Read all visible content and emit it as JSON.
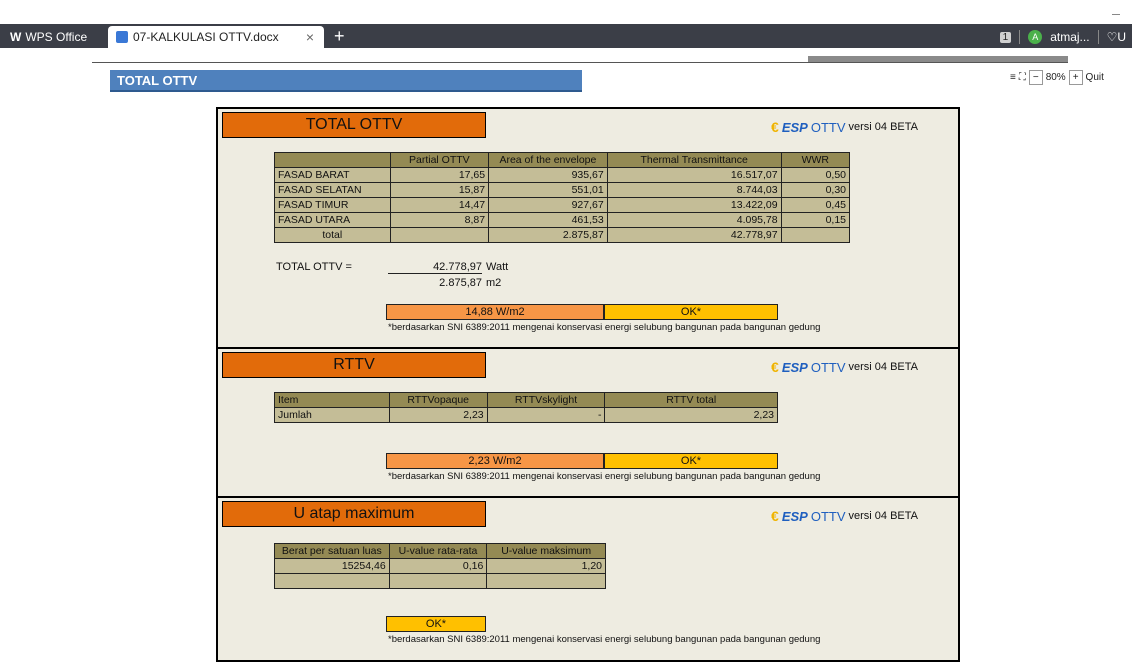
{
  "app": {
    "home_tab": "WPS Office",
    "doc_tab": "07-KALKULASI OTTV.docx",
    "tab_close": "×",
    "tab_add": "+",
    "window_badge": "1",
    "user_initial": "A",
    "user_name": "atmaj...",
    "right_label": "♡U"
  },
  "view": {
    "zoom": "80%",
    "zoom_minus": "−",
    "zoom_plus": "+",
    "quit": "Quit"
  },
  "doc": {
    "heading": "TOTAL OTTV"
  },
  "brand": {
    "euro": "€",
    "esp": "ESP",
    "ottv": "OTTV",
    "version": "versi 04 BETA"
  },
  "total_ottv": {
    "title": "TOTAL  OTTV",
    "headers": [
      "",
      "Partial OTTV",
      "Area of the envelope",
      "Thermal Transmittance",
      "WWR"
    ],
    "rows": [
      [
        "FASAD BARAT",
        "17,65",
        "935,67",
        "16.517,07",
        "0,50"
      ],
      [
        "FASAD SELATAN",
        "15,87",
        "551,01",
        "8.744,03",
        "0,30"
      ],
      [
        "FASAD TIMUR",
        "14,47",
        "927,67",
        "13.422,09",
        "0,45"
      ],
      [
        "FASAD UTARA",
        "8,87",
        "461,53",
        "4.095,78",
        "0,15"
      ]
    ],
    "total_row": [
      "total",
      "",
      "2.875,87",
      "42.778,97",
      ""
    ],
    "calc_label": "TOTAL OTTV =",
    "numerator": "42.778,97",
    "numerator_unit": "Watt",
    "denominator": "2.875,87",
    "denominator_unit": "m2",
    "result": "14,88 W/m2",
    "status": "OK*",
    "note": "*berdasarkan SNI 6389:2011 mengenai konservasi energi selubung bangunan pada bangunan gedung"
  },
  "rttv": {
    "title": "RTTV",
    "headers": [
      "Item",
      "RTTVopaque",
      "RTTVskylight",
      "RTTV total"
    ],
    "row": [
      "Jumlah",
      "2,23",
      "-",
      "2,23"
    ],
    "result": "2,23 W/m2",
    "status": "OK*",
    "note": "*berdasarkan SNI 6389:2011 mengenai konservasi energi selubung bangunan pada bangunan gedung"
  },
  "u_atap": {
    "title": "U atap maximum",
    "headers": [
      "Berat per satuan luas",
      "U-value rata-rata",
      "U-value maksimum"
    ],
    "row": [
      "15254,46",
      "0,16",
      "1,20"
    ],
    "status": "OK*",
    "note": "*berdasarkan SNI 6389:2011 mengenai konservasi energi selubung bangunan pada bangunan gedung"
  },
  "colors": {
    "tab_strip": "#3b3e47",
    "heading_blue": "#4f81bd",
    "sheet_bg": "#eeece1",
    "title_orange": "#e26b0a",
    "header_olive": "#948a54",
    "cell_tan": "#c4bd97",
    "result_orange": "#f79646",
    "ok_gold": "#ffc000",
    "brand_blue": "#1f5fbf"
  }
}
